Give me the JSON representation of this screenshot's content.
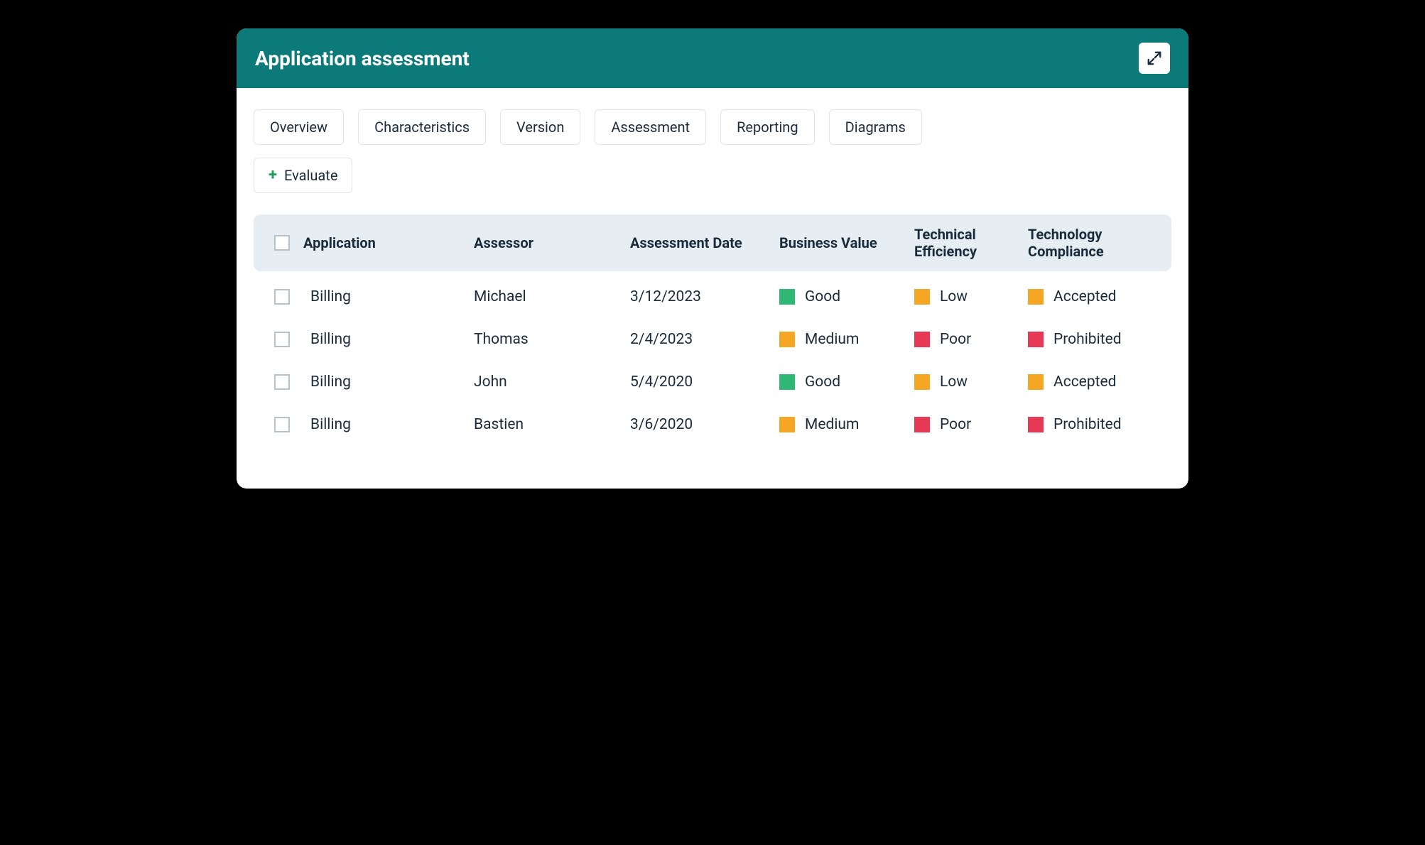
{
  "title": "Application assessment",
  "tabs": [
    {
      "label": "Overview"
    },
    {
      "label": "Characteristics"
    },
    {
      "label": "Version"
    },
    {
      "label": "Assessment"
    },
    {
      "label": "Reporting"
    },
    {
      "label": "Diagrams"
    }
  ],
  "evaluate_label": "Evaluate",
  "columns": {
    "application": "Application",
    "assessor": "Assessor",
    "assessment_date": "Assessment Date",
    "business_value": "Business Value",
    "technical_efficiency": "Technical Efficiency",
    "technology_compliance": "Technology Compliance"
  },
  "status_colors": {
    "green": "#2eb873",
    "orange": "#f5a623",
    "red": "#e63956"
  },
  "rows": [
    {
      "application": "Billing",
      "assessor": "Michael",
      "date": "3/12/2023",
      "business_value": {
        "label": "Good",
        "color": "green"
      },
      "technical_efficiency": {
        "label": "Low",
        "color": "orange"
      },
      "technology_compliance": {
        "label": "Accepted",
        "color": "orange"
      }
    },
    {
      "application": "Billing",
      "assessor": "Thomas",
      "date": "2/4/2023",
      "business_value": {
        "label": "Medium",
        "color": "orange"
      },
      "technical_efficiency": {
        "label": "Poor",
        "color": "red"
      },
      "technology_compliance": {
        "label": "Prohibited",
        "color": "red"
      }
    },
    {
      "application": "Billing",
      "assessor": "John",
      "date": "5/4/2020",
      "business_value": {
        "label": "Good",
        "color": "green"
      },
      "technical_efficiency": {
        "label": "Low",
        "color": "orange"
      },
      "technology_compliance": {
        "label": "Accepted",
        "color": "orange"
      }
    },
    {
      "application": "Billing",
      "assessor": "Bastien",
      "date": "3/6/2020",
      "business_value": {
        "label": "Medium",
        "color": "orange"
      },
      "technical_efficiency": {
        "label": "Poor",
        "color": "red"
      },
      "technology_compliance": {
        "label": "Prohibited",
        "color": "red"
      }
    }
  ]
}
